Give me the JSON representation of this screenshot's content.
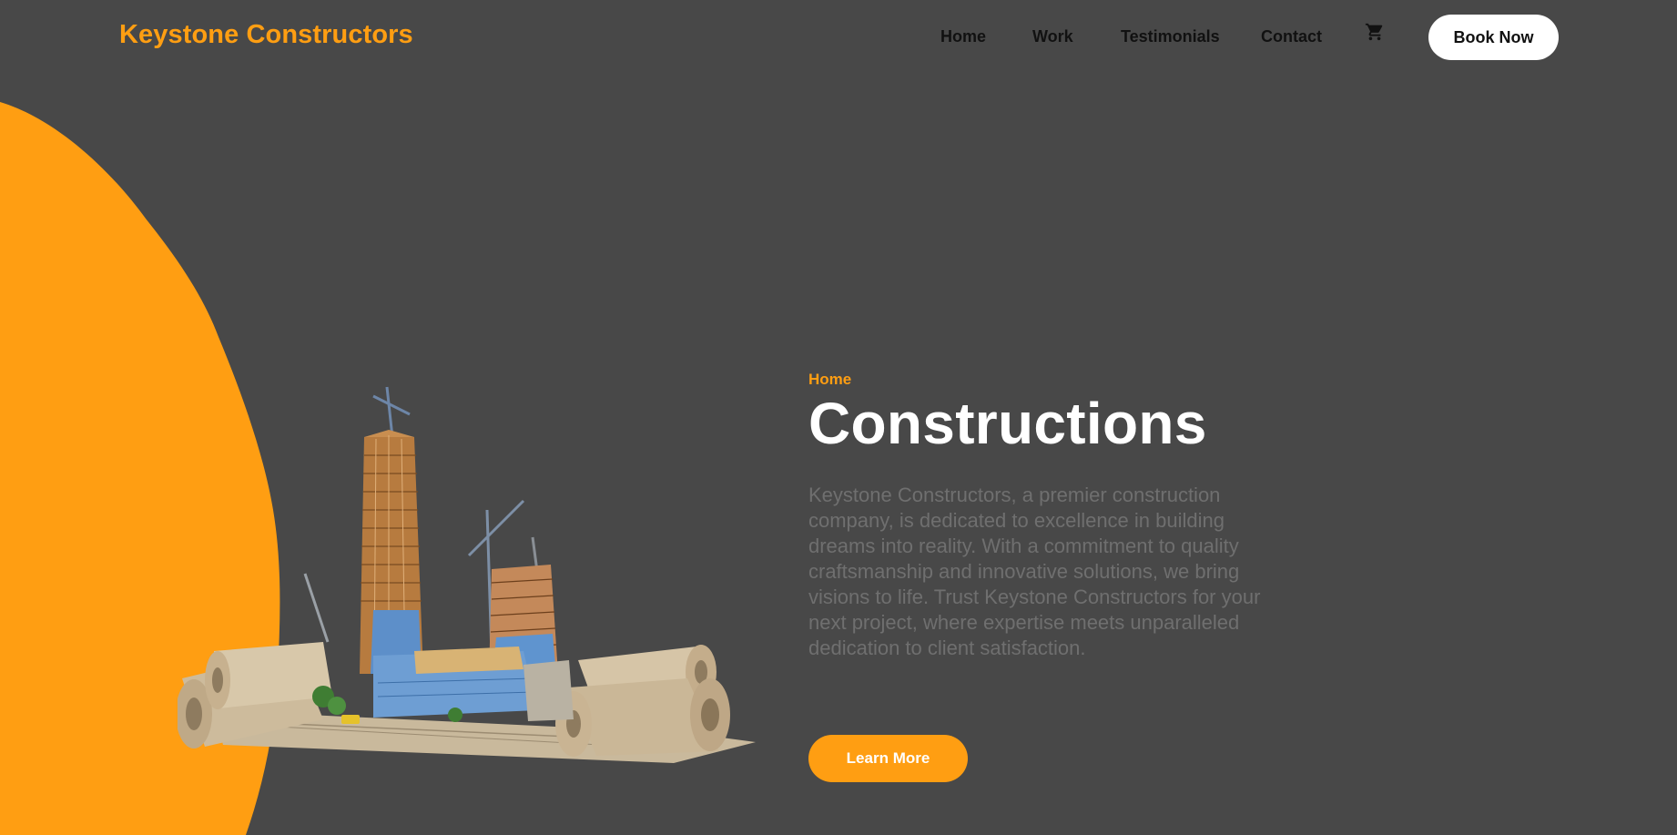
{
  "header": {
    "brand": "Keystone Constructors",
    "nav": [
      {
        "label": "Home"
      },
      {
        "label": "Work"
      },
      {
        "label": "Testimonials"
      },
      {
        "label": "Contact"
      }
    ],
    "cart_icon": "shopping-cart-icon",
    "book_label": "Book Now"
  },
  "hero": {
    "breadcrumb": "Home",
    "title": "Constructions",
    "description": "Keystone Constructors, a premier construction company, is dedicated to excellence in building dreams into reality. With a commitment to quality craftsmanship and innovative solutions, we bring visions to life. Trust Keystone Constructors for your next project, where expertise meets unparalleled dedication to client satisfaction.",
    "cta_label": "Learn More",
    "image": "construction-city-on-blueprints"
  },
  "colors": {
    "background": "#484848",
    "accent": "#ff9e12",
    "button_light": "#ffffff",
    "description_text": "#6f6f6f"
  }
}
